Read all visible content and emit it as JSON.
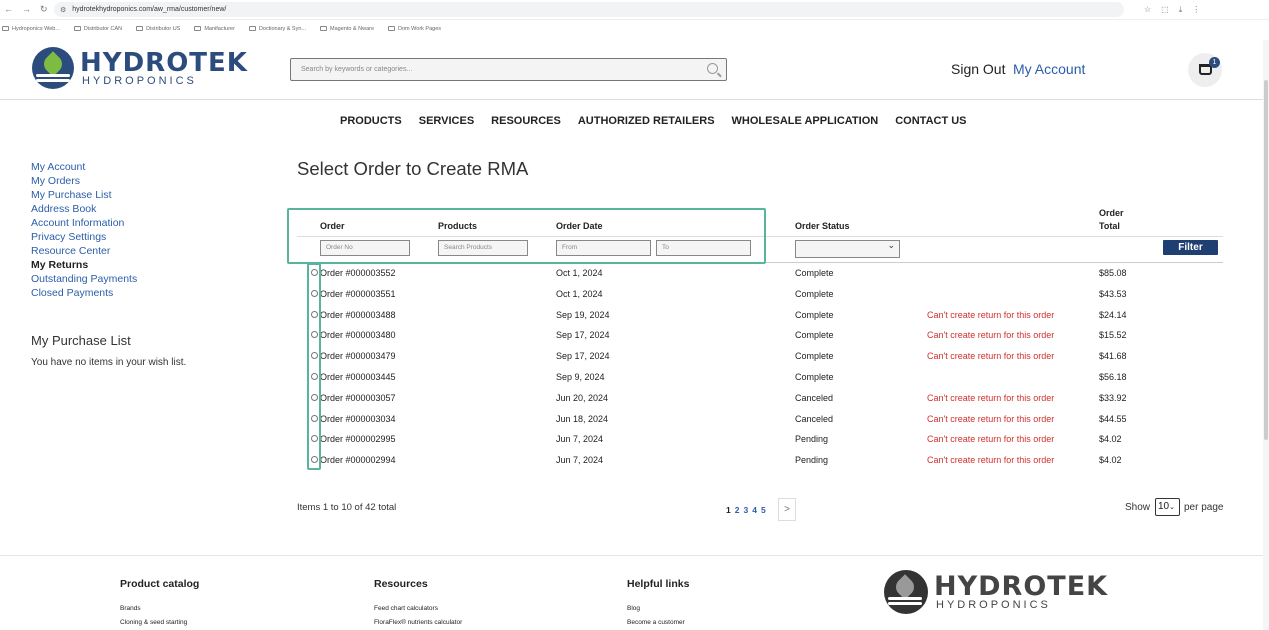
{
  "browser": {
    "url": "hydrotekhydroponics.com/aw_rma/customer/new/",
    "bookmarks": [
      "Hydroponics Web...",
      "Distributor CAN",
      "Distributor US",
      "Manifacturer",
      "Doctionary & Syn...",
      "Magento & Nware",
      "Dom Work Pages"
    ]
  },
  "header": {
    "logo_main": "HYDROTEK",
    "logo_sub": "HYDROPONICS",
    "search_placeholder": "Search by keywords or categories...",
    "sign_out": "Sign Out",
    "my_account": "My Account",
    "cart_count": "1"
  },
  "nav": [
    "PRODUCTS",
    "SERVICES",
    "RESOURCES",
    "AUTHORIZED RETAILERS",
    "WHOLESALE APPLICATION",
    "CONTACT US"
  ],
  "sidebar": {
    "links": [
      "My Account",
      "My Orders",
      "My Purchase List",
      "Address Book",
      "Account Information",
      "Privacy Settings",
      "Resource Center",
      "My Returns",
      "Outstanding Payments",
      "Closed Payments"
    ],
    "active": "My Returns",
    "wish_title": "My Purchase List",
    "wish_text": "You have no items in your wish list."
  },
  "main": {
    "title": "Select Order to Create RMA",
    "headers": {
      "order": "Order",
      "products": "Products",
      "order_date": "Order Date",
      "order_status": "Order Status",
      "order_total_1": "Order",
      "order_total_2": "Total"
    },
    "filters": {
      "order_no": "Order No",
      "products": "Search Products",
      "from": "From",
      "to": "To",
      "button": "Filter"
    },
    "rows": [
      {
        "order": "Order #000003552",
        "date": "Oct 1, 2024",
        "status": "Complete",
        "msg": "",
        "total": "$85.08"
      },
      {
        "order": "Order #000003551",
        "date": "Oct 1, 2024",
        "status": "Complete",
        "msg": "",
        "total": "$43.53"
      },
      {
        "order": "Order #000003488",
        "date": "Sep 19, 2024",
        "status": "Complete",
        "msg": "Can't create return for this order",
        "total": "$24.14"
      },
      {
        "order": "Order #000003480",
        "date": "Sep 17, 2024",
        "status": "Complete",
        "msg": "Can't create return for this order",
        "total": "$15.52"
      },
      {
        "order": "Order #000003479",
        "date": "Sep 17, 2024",
        "status": "Complete",
        "msg": "Can't create return for this order",
        "total": "$41.68"
      },
      {
        "order": "Order #000003445",
        "date": "Sep 9, 2024",
        "status": "Complete",
        "msg": "",
        "total": "$56.18"
      },
      {
        "order": "Order #000003057",
        "date": "Jun 20, 2024",
        "status": "Canceled",
        "msg": "Can't create return for this order",
        "total": "$33.92"
      },
      {
        "order": "Order #000003034",
        "date": "Jun 18, 2024",
        "status": "Canceled",
        "msg": "Can't create return for this order",
        "total": "$44.55"
      },
      {
        "order": "Order #000002995",
        "date": "Jun 7, 2024",
        "status": "Pending",
        "msg": "Can't create return for this order",
        "total": "$4.02"
      },
      {
        "order": "Order #000002994",
        "date": "Jun 7, 2024",
        "status": "Pending",
        "msg": "Can't create return for this order",
        "total": "$4.02"
      }
    ],
    "pagination": {
      "items_text": "Items 1 to 10 of 42 total",
      "pages": [
        "1",
        "2",
        "3",
        "4",
        "5"
      ],
      "current": "1",
      "next": ">",
      "show": "Show",
      "per_page_value": "10",
      "per_page": "per page"
    }
  },
  "footer": {
    "col1": {
      "title": "Product catalog",
      "links": [
        "Brands",
        "Cloning & seed starting"
      ]
    },
    "col2": {
      "title": "Resources",
      "links": [
        "Feed chart calculators",
        "FloraFlex® nutrients calculator"
      ]
    },
    "col3": {
      "title": "Helpful links",
      "links": [
        "Blog",
        "Become a customer"
      ]
    },
    "logo_main": "HYDROTEK",
    "logo_sub": "HYDROPONICS"
  },
  "colors": {
    "brand": "#2c4c7e",
    "link": "#2b5ea8",
    "error": "#d0312d",
    "highlight": "#56b59a"
  }
}
